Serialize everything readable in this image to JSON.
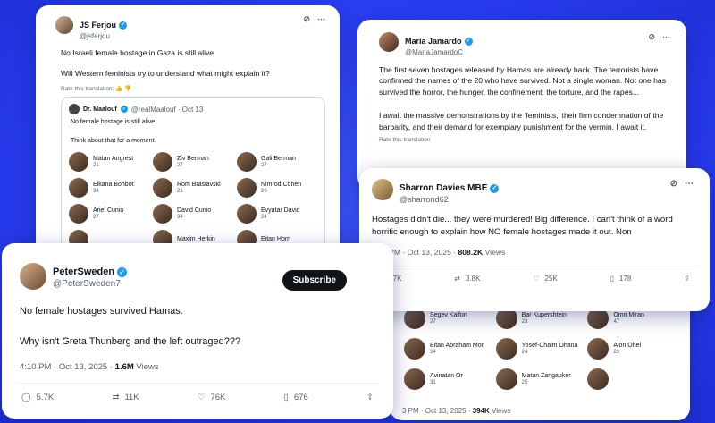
{
  "colors": {
    "background": "#2a3df2",
    "verified": "#1d9bf0",
    "text": "#0f1419",
    "muted": "#536471"
  },
  "card_ferjou": {
    "display_name": "JS Ferjou",
    "handle": "@jsferjou",
    "text": "No Israeli female hostage in Gaza is still alive\n\nWill Western feminists try to understand what might explain it?",
    "translate": "Rate this translation: 👍 👎",
    "quote": {
      "display_name": "Dr. Maalouf",
      "handle": "@realMaalouf · Oct 13",
      "text": "No female hostage is still alive.\n\nThink about that for a moment.",
      "people": [
        {
          "name": "Matan Angrest",
          "age": "21"
        },
        {
          "name": "Ziv Berman",
          "age": "27"
        },
        {
          "name": "Gali Berman",
          "age": "27"
        },
        {
          "name": "Elkana Bohbot",
          "age": "34"
        },
        {
          "name": "Rom Braslavski",
          "age": "21"
        },
        {
          "name": "Nimrod Cohen",
          "age": "20"
        },
        {
          "name": "Ariel Cunio",
          "age": "27"
        },
        {
          "name": "David Cunio",
          "age": "34"
        },
        {
          "name": "Evyatar David",
          "age": "24"
        },
        {
          "name": "",
          "age": ""
        },
        {
          "name": "Maxim Herkin",
          "age": ""
        },
        {
          "name": "Eitan Horn",
          "age": ""
        }
      ]
    }
  },
  "card_jamardo": {
    "display_name": "María Jamardo",
    "handle": "@MariaJamardoC",
    "text": "The first seven hostages released by Hamas are already back. The terrorists have confirmed the names of the 20 who have survived. Not a single woman. Not one has survived the horror, the hunger, the confinement, the torture, and the rapes...\n\nI await the massive demonstrations by the ‘feminists,’ their firm condemnation of the barbarity, and their demand for exemplary punishment for the vermin. I await it.",
    "translate": "Rate this translation"
  },
  "card_davies": {
    "display_name": "Sharron Davies MBE",
    "handle": "@sharrond62",
    "text": "Hostages didn't die... they were murdered! Big difference. I can't think of a word horrific enough to explain how NO female hostages made it out. Non",
    "time": "7:23 PM · Oct 13, 2025 · ",
    "views": "808.2K",
    "views_label": " Views",
    "replies": "3.7K",
    "reposts": "3.8K",
    "likes": "25K",
    "bookmarks": "178"
  },
  "card_grid": {
    "people": [
      {
        "name": "Segev Kalfon",
        "age": "27"
      },
      {
        "name": "Bar Kupershtein",
        "age": "23"
      },
      {
        "name": "Omri Miran",
        "age": "47"
      },
      {
        "name": "Eitan Abraham Mor",
        "age": "24"
      },
      {
        "name": "Yosef-Chaim Ohana",
        "age": "24"
      },
      {
        "name": "Alon Ohel",
        "age": "23"
      },
      {
        "name": "Avinatan Or",
        "age": "31"
      },
      {
        "name": "Matan Zangauker",
        "age": "25"
      },
      {
        "name": "",
        "age": ""
      }
    ],
    "time": "3 PM · Oct 13, 2025 · ",
    "views": "394K",
    "views_label": " Views"
  },
  "card_sweden": {
    "display_name": "PeterSweden",
    "handle": "@PeterSweden7",
    "subscribe_label": "Subscribe",
    "text": "No female hostages survived Hamas.\n\nWhy isn't Greta Thunberg and the left outraged???",
    "time": "4:10 PM · Oct 13, 2025 · ",
    "views": "1.6M",
    "views_label": " Views",
    "replies": "5.7K",
    "reposts": "11K",
    "likes": "76K",
    "bookmarks": "676"
  }
}
